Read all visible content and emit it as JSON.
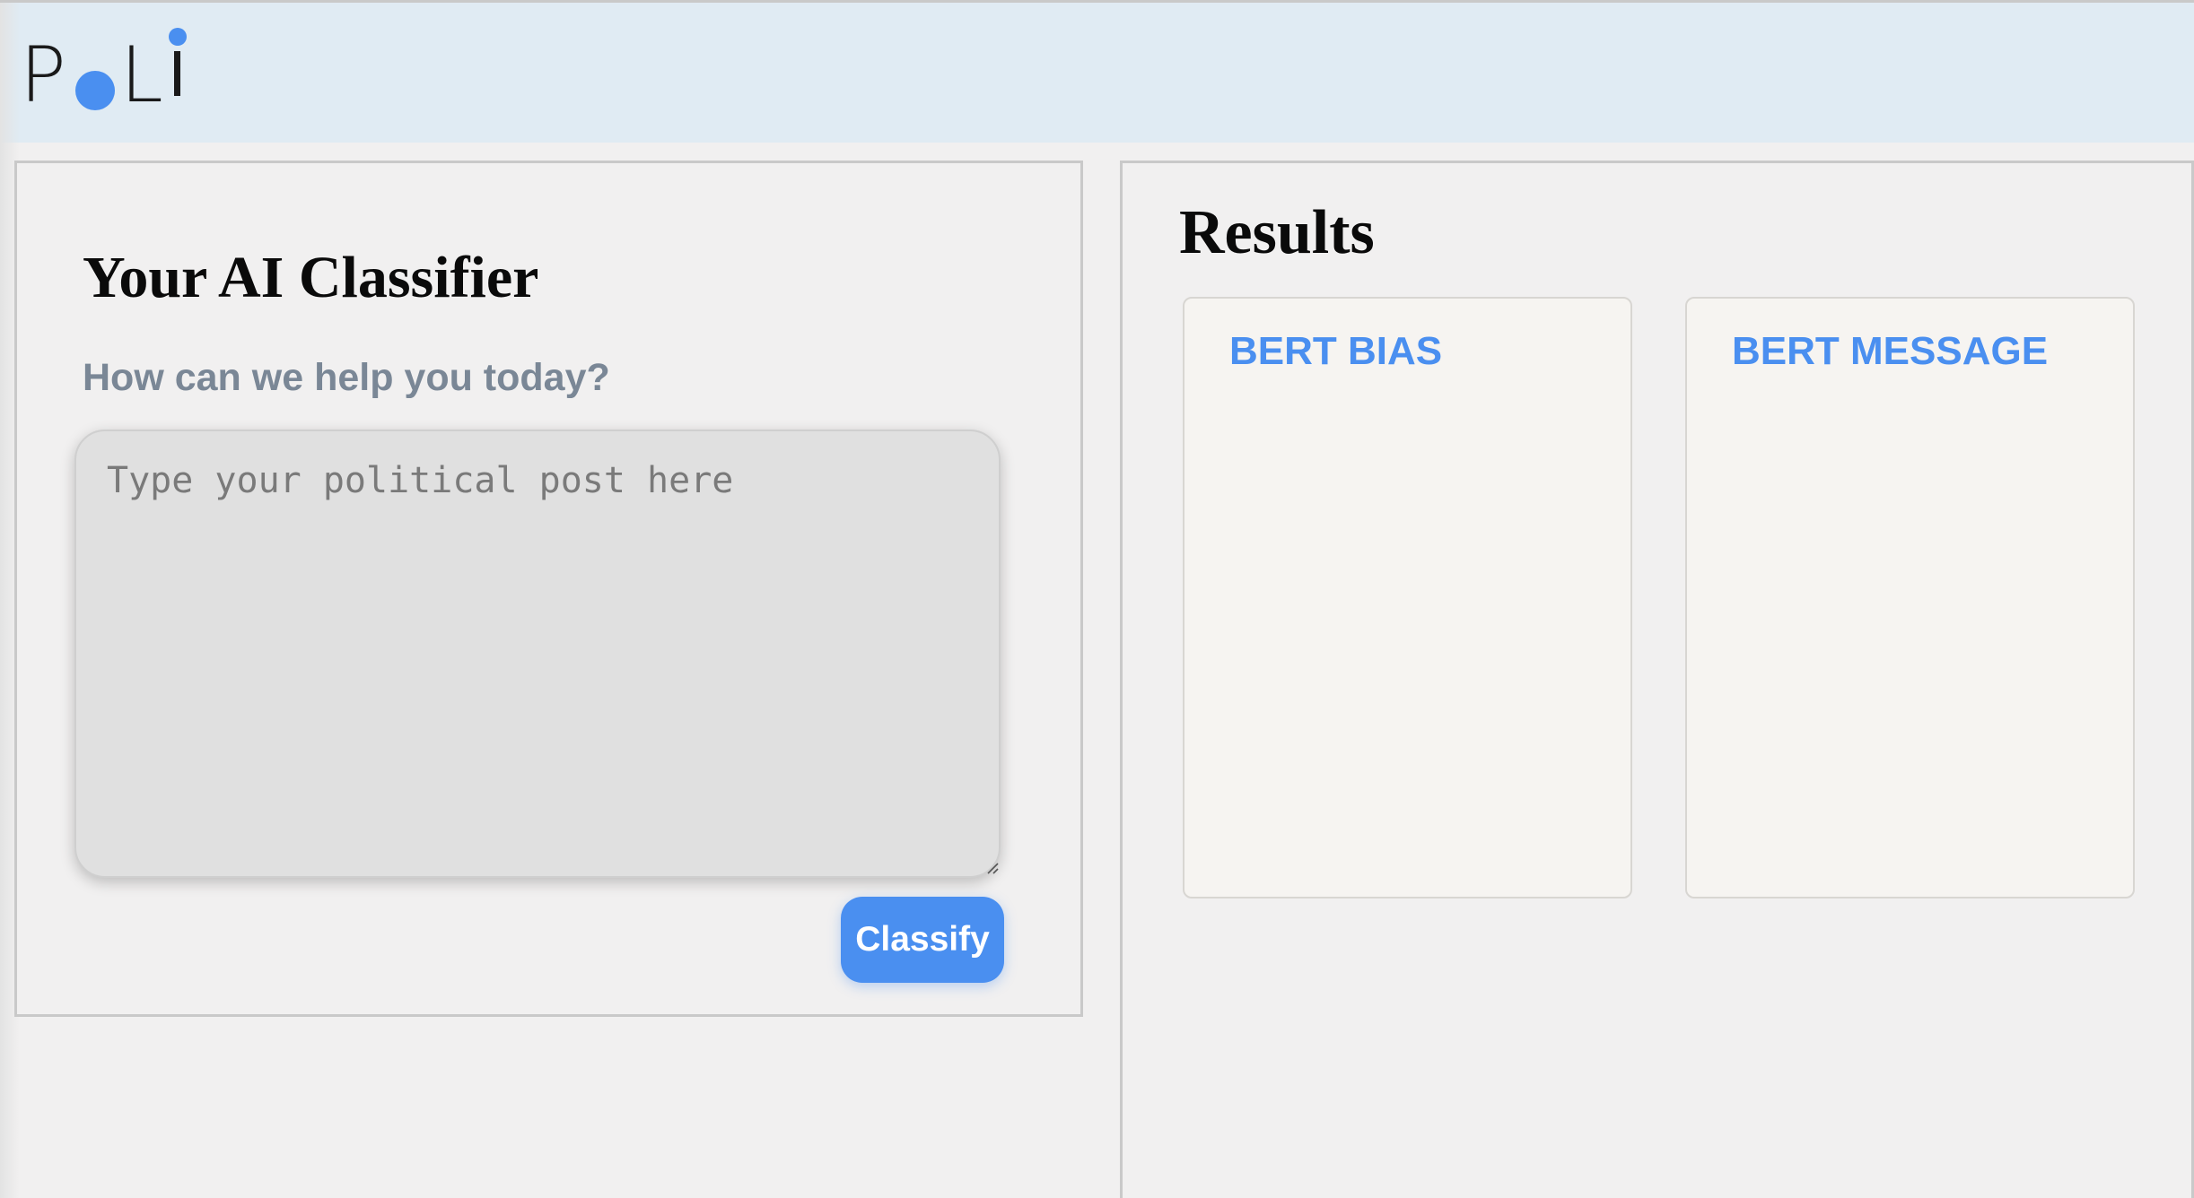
{
  "header": {
    "logo": {
      "letters": [
        "P",
        "L"
      ],
      "accent_color": "#4a8ff0"
    }
  },
  "classifier": {
    "title": "Your AI Classifier",
    "subtitle": "How can we help you today?",
    "input": {
      "value": "",
      "placeholder": "Type your political post here"
    },
    "classify_label": "Classify"
  },
  "results": {
    "title": "Results",
    "cards": [
      {
        "title": "BERT BIAS",
        "content": ""
      },
      {
        "title": "BERT MESSAGE",
        "content": ""
      }
    ]
  },
  "colors": {
    "accent": "#4a8ff0",
    "header_bg": "#e0ebf3",
    "page_bg": "#f1f0f0",
    "subtitle": "#7a8796"
  },
  "icons": [
    "logo-dot-icon",
    "resize-grip-icon"
  ]
}
